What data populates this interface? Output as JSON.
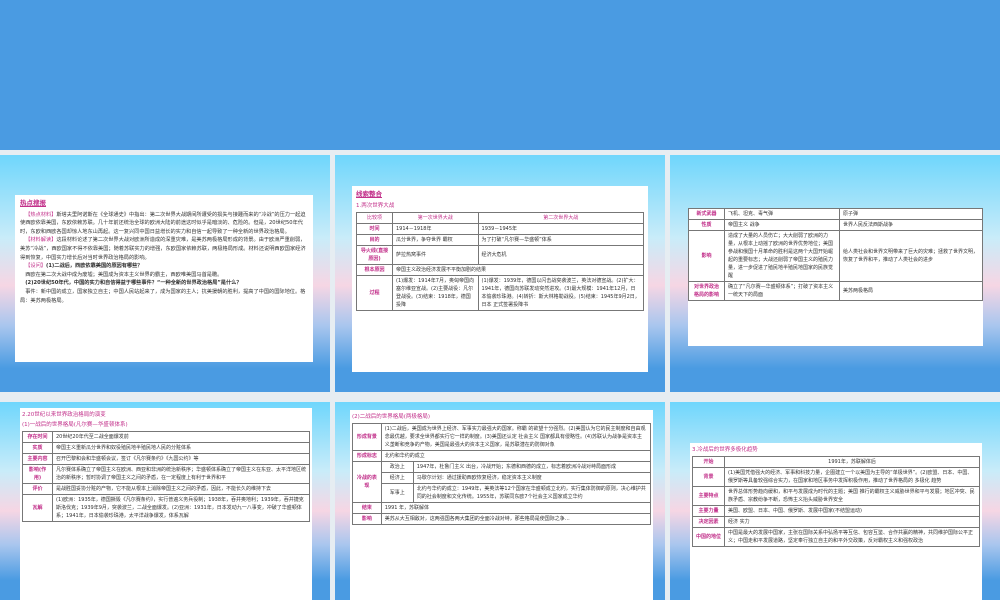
{
  "slide1": {
    "title": "热点搜报",
    "p1_tag": "【热点材料】",
    "p1": "斯塔夫里阿诺斯在《全球通史》中指出：第二次世界大战期间所遭受的损失与接踵而来的“冷战”的压力一起迫使西欧依靠美国，东欧依赖苏联。几十年前还统治全球的欧洲大陆的前途这时似乎是暗淡的、危险的。但是，20世纪50年代时，东欧和西欧各国却惊人地东山再起。这一复兴同中国日益增长的实力和自信一起导致了一种全新的世界政治格局。",
    "p2_tag": "【材料解读】",
    "p2": "这段材料论述了第二次世界大战对欧洲所造成的深重灾难，是美苏两极格局形成的背景。由于欧洲严重削弱，美苏“冷战”，西欧国家不得不依靠美国；随着苏联实力的增强，东欧国家依赖苏联，两极格局形成。材料还说明西欧国家经济得到恢复，中国实力增长后对当时世界政治格局的影响。",
    "q_tag": "【设问】",
    "q1": "(1)二战后，西欧依靠美国的原因有哪些？",
    "a1": "西欧在第二次大战中成为废墟；美国成为资本主义世界的霸主，西欧唯美国马首是瞻。",
    "q2": "(2)20世纪50年代，中国的实力和自信得益于哪些事件？“一种全新的世界政治格局”是什么？",
    "a2": "事件：新中国的成立，国家独立自主；中国人民站起来了，成为国家的主人；抗美援朝的胜利，提高了中国的国际地位。格局：美苏两极格局。"
  },
  "slide2": {
    "title": "线索整合",
    "subtitle": "1.两次世界大战",
    "headers": [
      "比较项",
      "第一次世界大战",
      "第二次世界大战"
    ],
    "rows": [
      [
        "时间",
        "1914－1918年",
        "1939－1945年"
      ],
      [
        "目的",
        "瓜分世界，争夺世界 霸权",
        "为了打破“凡尔赛—华盛顿”体系"
      ],
      [
        "导火线(直接原因)",
        "萨拉热窝事件",
        "经济大危机"
      ],
      [
        "根本原因",
        "帝国主义政治经济发展不平衡加剧的结果",
        ""
      ],
      [
        "过程",
        "(1)爆发：1914年7月，奥匈帝国向塞尔维亚宣战。(2)主要战役：凡尔登战役。(3)结束：1918年，德国投降",
        "(1)爆发：1939年，德国以闪击战突袭波兰，英法对德宣战。(2)扩大：1941年，德国向苏联发动突然进攻。(3)最大规模：1941年12月，日本偷袭珍珠港。(4)转折：斯大林格勒战役。(5)结束：1945年9月2日，日本 正式签署投降书"
      ]
    ]
  },
  "slide3": {
    "rows": [
      [
        "新式武器",
        "飞机、坦克、毒气弹",
        "原子弹"
      ],
      [
        "性质",
        "帝国主义 战争",
        "世界人民反法西斯战争"
      ],
      [
        "影响",
        "造成了大量的人员伤亡；大大削弱了欧洲的力量，从根本上动摇了欧洲的世界优势地位；美国参战和俄国十月革命的胜利是这两个大国开始崛起的重要标志；大战还削弱了帝国主义的殖民力量，进一步促进了殖民地半殖民地国家的民族觉醒",
        "给人类社会和世界文明带来了巨大的灾难；拯救了世界文明，恢复了世界和平，推动了人类社会的进步"
      ],
      [
        "对世界政治格局的影响",
        "确立了“凡尔赛—华盛顿体系”；打破了资本主义一统天下的局面",
        "美苏两极格局"
      ]
    ]
  },
  "slide4": {
    "heading": "2.20世纪以来世界政治格局的演变",
    "subheading": "(1)一战后的世界格局(凡尔赛—华盛顿体系)",
    "rows": [
      [
        "存在时间",
        "20世纪20年代至二战全面爆发前"
      ],
      [
        "实质",
        "帝国主义重新瓜分世界和奴役殖民地半殖民地人民的分赃体系"
      ],
      [
        "主要内容",
        "召开巴黎和会和华盛顿会议，签订《凡尔赛条约》《九国公约》等"
      ],
      [
        "影响(作用)",
        "凡尔赛体系确立了帝国主义在欧洲、西亚和非洲的统治新秩序；华盛顿体系确立了帝国主义在东亚、太平洋地区统治的新秩序；暂时协调了帝国主义之间的矛盾，在一定程度上有利于世界和平"
      ],
      [
        "评价",
        "是战胜国妥协分赃的产物，它不能从根本上消除帝国主义之间的矛盾，因此，不能长久的维持下去"
      ],
      [
        "瓦解",
        "(1)欧洲：1935年，德国撕毁《凡尔赛条约》，实行普遍义务兵役制；1938年，吞并奥地利；1939年，吞并捷克斯洛伐克；1939年9月，突袭波兰，二战全面爆发。(2)亚洲：1931年，日本发动九一八事变，冲破了华盛顿体系；1941年，日本偷袭珍珠港，太平洋战争爆发，体系瓦解"
      ]
    ]
  },
  "slide5": {
    "subheading": "(2)二战后的世界格局(两极格局)",
    "background_k": "形成背景",
    "background": "(1)二战后，美国成为世界上经济、军事实力最强大的国家。称霸 的欲望十分强烈。(2)美国认为它的民主制度和自由观念最优越，要求全世界都实行它一样的制度。(3)美国还认定 社会主义 国家都具有侵略性。(4)苏联认为战争是资本主义垄断和竞争的产物，美国是最强大的资本主义国家，是苏联潜在的防御对象",
    "mark_k": "形成标志",
    "mark": "北约和华约的成立",
    "cw_k": "冷战的表现",
    "cw": [
      [
        "政治上",
        "1947年，杜鲁门主义 出台，冷战开始；东德和西德的成立，标志着欧洲冷战对峙局面形成"
      ],
      [
        "经济上",
        "马歇尔计划：通过援助西欧恢复经济，稳定资本主义制度"
      ],
      [
        "军事上",
        "北约与华约的成立：1949年，美英法等12个国家在华盛顿成立北约，实行集体防御的原则，决心维护共同的社会制度和文化传统。1955年，苏联同东欧7个社会主义国家成立华约"
      ]
    ],
    "end_k": "结束",
    "end": "1991 年，苏联解体",
    "impact_k": "影响",
    "impact": "美苏从大互相敌对，这两强国各两大集团的全面冷战对峙，那些格局是使国际之争…"
  },
  "slide6": {
    "heading": "3.冷战后的世界多极化趋势",
    "rows": [
      [
        "开始",
        "1991年，苏联解体后"
      ],
      [
        "背景",
        "(1)美国凭借强大的经济、军事和科技力量，企图建立一个以美国为主导的“单极世界”。(2)欧盟、日本、中国、俄罗斯等具备较强综合实力，在国家和地区事务中发挥积极作用，推动了世界格局的 多极化 趋势"
      ],
      [
        "主要特点",
        "世界总体形势趋向缓和，和平与发展成为时代的主题；美国 推行的霸权主义威胁世界和平与发展；地区冲突、民族矛盾、宗教纷争不断，恐怖主义抬头威胁世界安全"
      ],
      [
        "主要力量",
        "美国、欧盟、日本、中国、俄罗斯、发展中国家(不结盟运动)"
      ],
      [
        "决定因素",
        "经济 实力"
      ],
      [
        "中国的地位",
        "中国是最大的发展中国家，主张在国际关系中弘扬平等互信、包容互鉴、合作共赢的精神，共同维护国际公平正义；中国走和平发展道路，坚定奉行独立自主的和平外交政策，反对霸权主义和强权政治"
      ]
    ]
  }
}
